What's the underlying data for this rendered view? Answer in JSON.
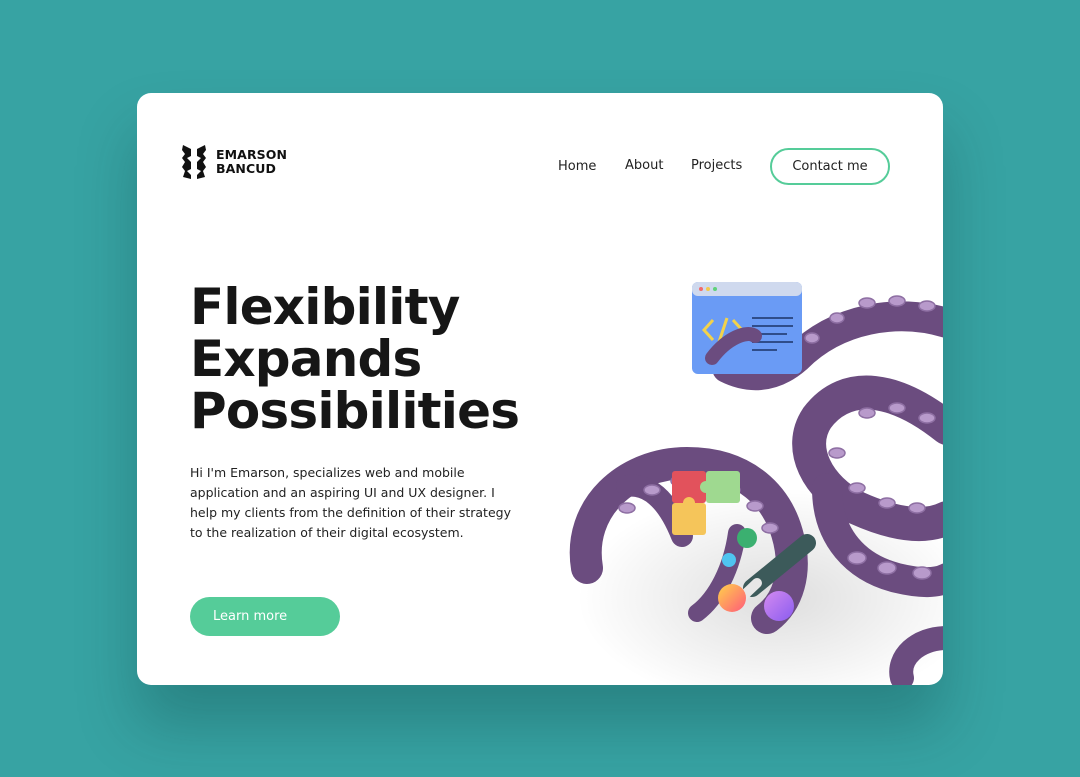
{
  "brand": {
    "line1": "EMARSON",
    "line2": "BANCUD"
  },
  "nav": {
    "home": "Home",
    "about": "About",
    "projects": "Projects",
    "contact": "Contact me"
  },
  "hero": {
    "headline": [
      "Flexibility",
      "Expands",
      "Possibilities"
    ],
    "description": "Hi I'm Emarson, specializes web and mobile application and an aspiring UI and UX designer. I help my clients from the definition of their strategy to the realization of their digital ecosystem.",
    "cta": "Learn more"
  },
  "icons": {
    "logo": "brand-logo-icon",
    "illustration": "octopus-illustration",
    "code": "code-window-icon",
    "puzzle": "puzzle-icon",
    "brush": "paint-brush-icon"
  },
  "colors": {
    "background": "#37a3a3",
    "accent": "#55cc99",
    "octopus": "#6b4c7f",
    "card": "#ffffff",
    "text": "#161616"
  }
}
